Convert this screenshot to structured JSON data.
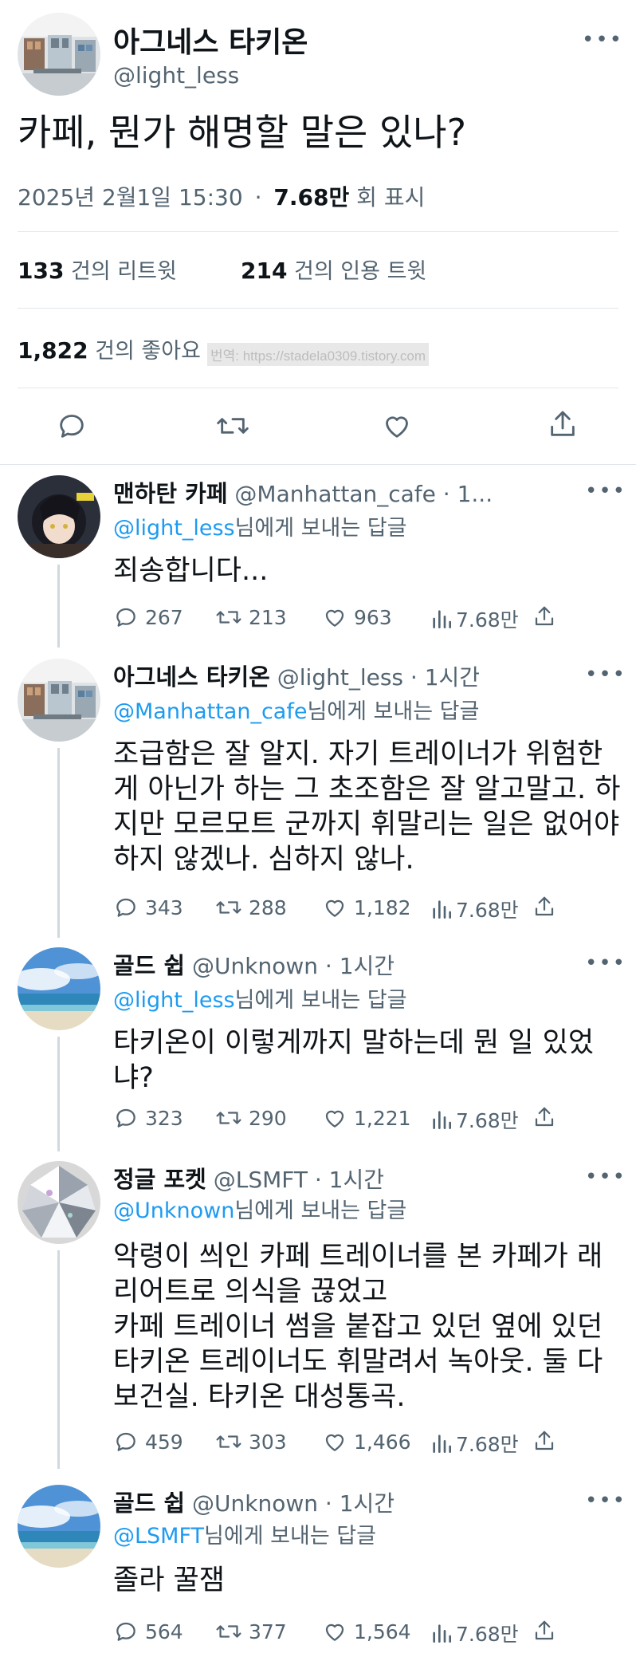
{
  "main_tweet": {
    "name": "아그네스 타키온",
    "handle": "@light_less",
    "more_label": "•••",
    "text": "카페, 뭔가 해명할 말은 있나?",
    "date": "2025년 2월1일  15:30",
    "dot": "·",
    "views": "7.68만",
    "views_label": "회 표시",
    "retweets": "133",
    "retweets_label": "건의 리트윗",
    "quotes": "214",
    "quotes_label": "건의 인용 트윗",
    "likes": "1,822",
    "likes_label": "건의 좋아요",
    "watermark": "번역: https://stadela0309.tistory.com"
  },
  "replying_suffix": "님에게 보내는 답글",
  "replies": [
    {
      "name": "맨하탄 카페",
      "handle": "@Manhattan_cafe · 1...",
      "to": "@light_less",
      "text": "죄송합니다...",
      "replies": "267",
      "retweets": "213",
      "likes": "963",
      "views": "7.68만"
    },
    {
      "name": "아그네스 타키온",
      "handle": "@light_less · 1시간",
      "to": "@Manhattan_cafe",
      "text": "조급함은 잘 알지. 자기 트레이너가 위험한 게 아닌가 하는 그 초조함은 잘 알고말고. 하지만 모르모트 군까지 휘말리는 일은 없어야 하지 않겠나. 심하지 않나.",
      "replies": "343",
      "retweets": "288",
      "likes": "1,182",
      "views": "7.68만"
    },
    {
      "name": "골드 쉽",
      "handle": "@Unknown · 1시간",
      "to": "@light_less",
      "text": "타키온이 이렇게까지 말하는데 뭔 일 있었냐?",
      "replies": "323",
      "retweets": "290",
      "likes": "1,221",
      "views": "7.68만"
    },
    {
      "name": "정글 포켓",
      "handle": "@LSMFT · 1시간",
      "to": "@Unknown",
      "text": "악령이 씌인 카페 트레이너를 본 카페가 래리어트로 의식을 끊었고\n카페 트레이너 썸을 붙잡고 있던 옆에 있던 타키온 트레이너도 휘말려서 녹아웃. 둘 다 보건실. 타키온 대성통곡.",
      "replies": "459",
      "retweets": "303",
      "likes": "1,466",
      "views": "7.68만"
    },
    {
      "name": "골드 쉽",
      "handle": "@Unknown · 1시간",
      "to": "@LSMFT",
      "text": "졸라 꿀잼",
      "replies": "564",
      "retweets": "377",
      "likes": "1,564",
      "views": "7.68만"
    }
  ]
}
